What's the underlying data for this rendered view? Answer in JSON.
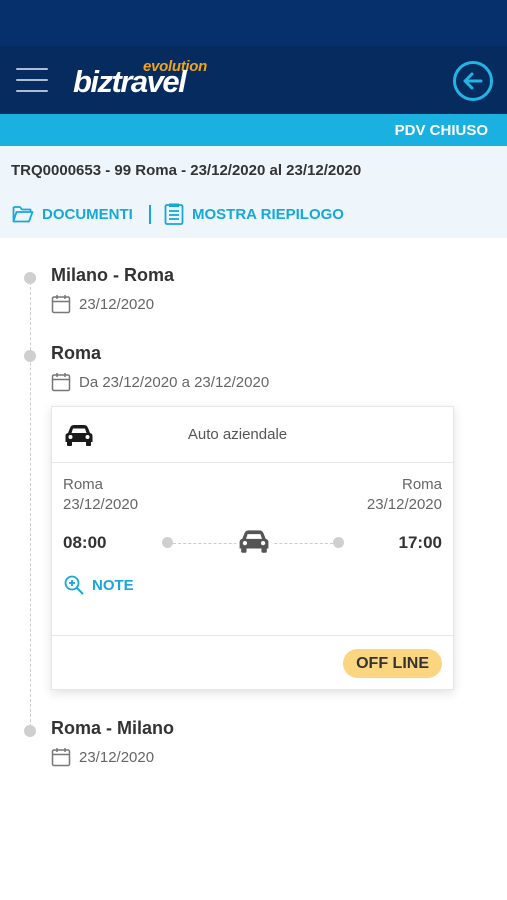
{
  "header": {
    "logo_sub": "evolution",
    "logo_main": "biztravel",
    "menu_icon": "hamburger-menu-icon",
    "back_icon": "arrow-left-circle-icon"
  },
  "status_bar": {
    "label": "PDV CHIUSO"
  },
  "trip": {
    "code_line": "TRQ0000653 - 99 Roma - 23/12/2020 al 23/12/2020",
    "documents_label": "DOCUMENTI",
    "summary_label": "MOSTRA RIEPILOGO"
  },
  "stops": [
    {
      "title": "Milano - Roma",
      "date": "23/12/2020"
    },
    {
      "title": "Roma",
      "date": "Da 23/12/2020 a 23/12/2020"
    },
    {
      "title": "Roma - Milano",
      "date": "23/12/2020"
    }
  ],
  "card": {
    "transport_type": "Auto aziendale",
    "from_city": "Roma",
    "from_date": "23/12/2020",
    "to_city": "Roma",
    "to_date": "23/12/2020",
    "departure_time": "08:00",
    "arrival_time": "17:00",
    "note_label": "NOTE",
    "status_badge": "OFF LINE"
  },
  "colors": {
    "navbar": "#062b5f",
    "accent": "#1ab1e0",
    "badge": "#fcd581",
    "logo_accent": "#f2a31b"
  }
}
